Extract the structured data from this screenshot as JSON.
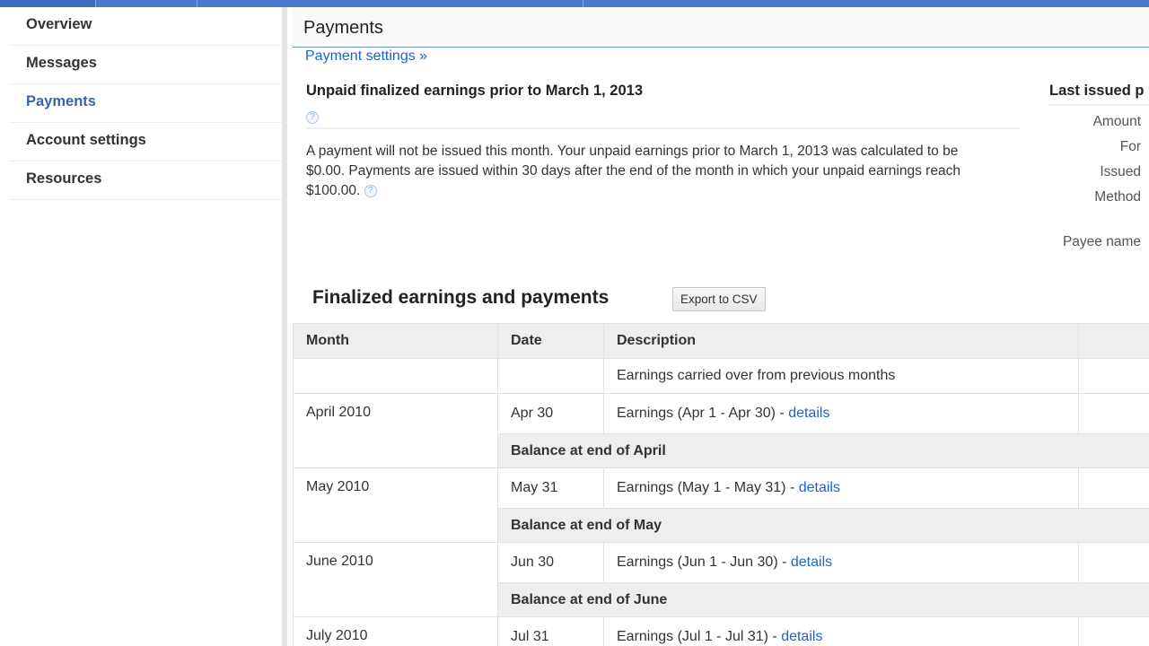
{
  "sidebar": {
    "items": [
      {
        "label": "Overview"
      },
      {
        "label": "Messages"
      },
      {
        "label": "Payments"
      },
      {
        "label": "Account settings"
      },
      {
        "label": "Resources"
      }
    ]
  },
  "page": {
    "title": "Payments",
    "settings_link": "Payment settings »"
  },
  "unpaid": {
    "heading": "Unpaid finalized earnings prior to March 1, 2013",
    "help": "?",
    "text": "A payment will not be issued this month. Your unpaid earnings prior to March 1, 2013 was calculated to be $0.00. Payments are issued within 30 days after the end of the month in which your unpaid earnings reach $100.00."
  },
  "last_issued": {
    "heading": "Last issued p",
    "labels": [
      "Amount",
      "For",
      "Issued",
      "Method",
      "Payee name"
    ]
  },
  "finalized": {
    "heading": "Finalized earnings and payments",
    "export_label": "Export to CSV",
    "columns": [
      "Month",
      "Date",
      "Description"
    ],
    "carried": "Earnings carried over from previous months",
    "months": [
      {
        "month": "April 2010",
        "date": "Apr 30",
        "desc": "Earnings (Apr 1 - Apr 30) - ",
        "link": "details",
        "balance": "Balance at end of April"
      },
      {
        "month": "May 2010",
        "date": "May 31",
        "desc": "Earnings (May 1 - May 31) - ",
        "link": "details",
        "balance": "Balance at end of May"
      },
      {
        "month": "June 2010",
        "date": "Jun 30",
        "desc": "Earnings (Jun 1 - Jun 30) - ",
        "link": "details",
        "balance": "Balance at end of June"
      },
      {
        "month": "July 2010",
        "date": "Jul 31",
        "desc": "Earnings (Jul 1 - Jul 31) - ",
        "link": "details"
      }
    ]
  }
}
